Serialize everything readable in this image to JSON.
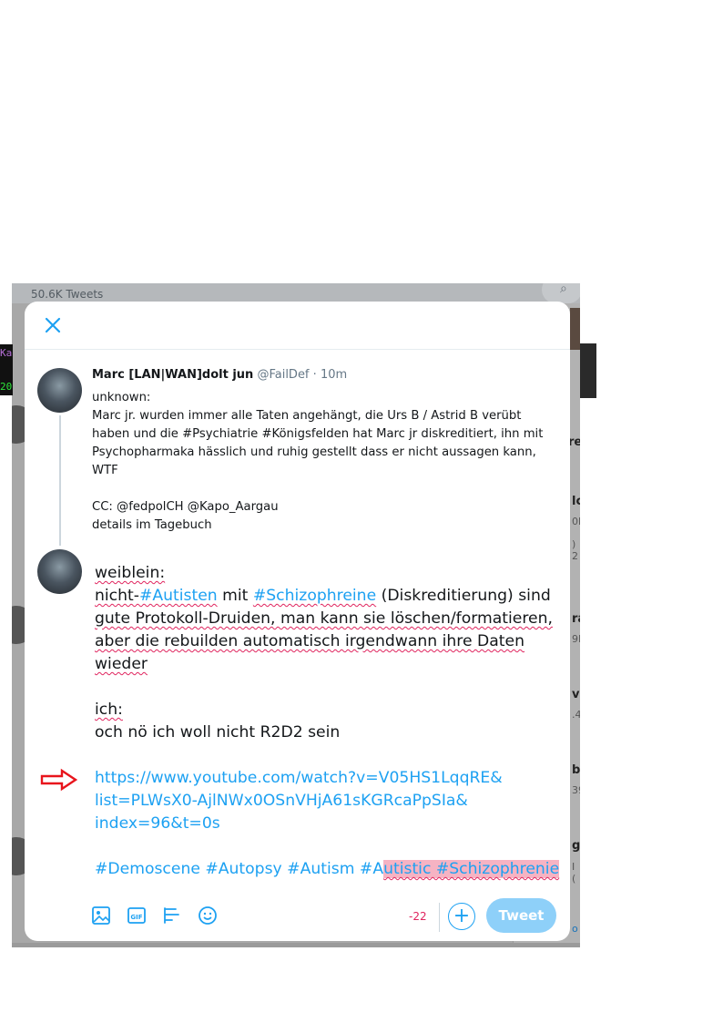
{
  "background": {
    "tweets_count": "50.6K Tweets",
    "right_column_fragments": [
      "re",
      "lc",
      "0l",
      ") 2",
      "ra",
      "9I",
      "vi",
      ".4",
      "br",
      "39",
      "gi",
      "I (",
      "o"
    ],
    "terminal_text": [
      "Ka",
      "20"
    ]
  },
  "modal": {
    "close_label": "×",
    "original_tweet": {
      "author_name": "Marc [LAN|WAN]dolt jun",
      "handle": "@FailDef",
      "separator": "·",
      "time": "10m",
      "lines": [
        "unknown:",
        "Marc jr. wurden immer alle Taten angehängt, die Urs B / Astrid B verübt haben und die #Psychiatrie #Königsfelden hat Marc jr diskreditiert, ihn mit Psychopharmaka hässlich und ruhig gestellt dass er nicht aussagen kann, WTF",
        "",
        "CC: @fedpolCH @Kapo_Aargau",
        "details im Tagebuch"
      ]
    },
    "compose": {
      "line1": "weiblein:",
      "line2_a": "nicht-",
      "line2_tag1": "#Autisten",
      "line2_b": " mit ",
      "line2_tag2": "#Schizophreine",
      "line2_c": " (Diskreditierung) sind",
      "line3": "gute Protokoll-Druiden, man kann sie löschen/formatieren,",
      "line4": "aber die rebuilden automatisch irgendwann ihre Daten",
      "line5": "wieder",
      "line6": "ich:",
      "line7": "och nö ich woll nicht R2D2 sein",
      "link_line1": "https://www.youtube.com/watch?v=V05HS1LqqRE&",
      "link_line2": "list=PLWsX0-AjlNWx0OSnVHjA61sKGRcaPpSIa&",
      "link_line3": "index=96&t=0s",
      "hashtags_normal": "#Demoscene #Autopsy #Autism #A",
      "hashtags_over": "utistic #Schizophrenie"
    },
    "toolbar": {
      "char_counter": "-22",
      "add_label": "+",
      "tweet_label": "Tweet"
    }
  },
  "colors": {
    "accent": "#1da1f2",
    "tweet_button_disabled": "#8ed0f9",
    "counter_over_limit": "#e0245e",
    "overflow_highlight": "#f6b3c3",
    "annotation_arrow": "#e8141c"
  }
}
